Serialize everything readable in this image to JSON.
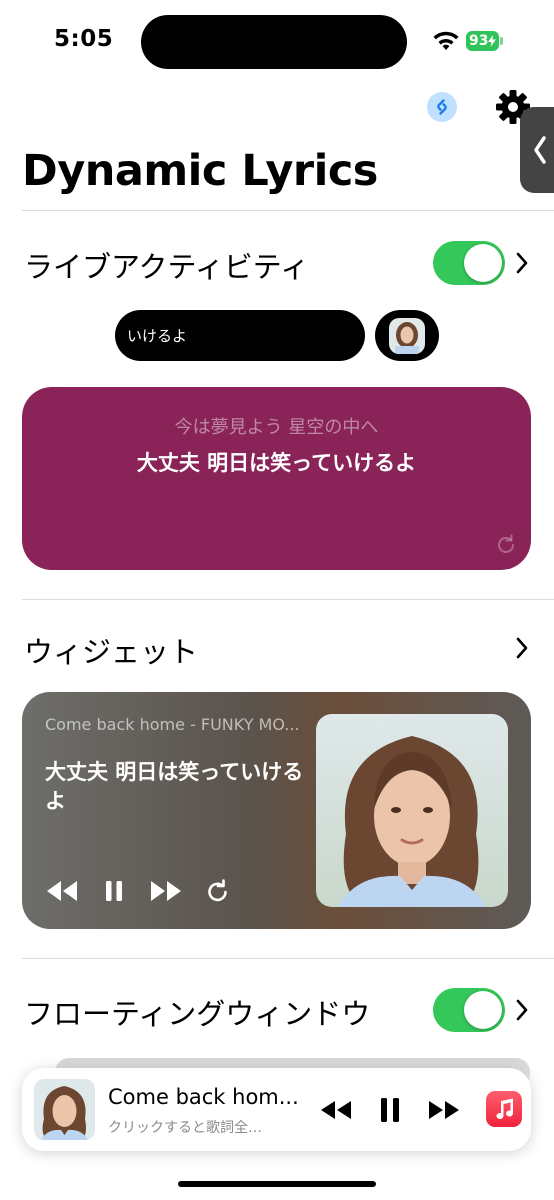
{
  "status_bar": {
    "time": "5:05",
    "battery": "93"
  },
  "header": {
    "title": "Dynamic Lyrics"
  },
  "live_activity": {
    "label": "ライブアクティビティ",
    "enabled": true,
    "island_text": "いけるよ",
    "previous_line": "今は夢見よう 星空の中へ",
    "current_line": "大丈夫 明日は笑っていけるよ",
    "card_color": "#8a2458"
  },
  "widget": {
    "label": "ウィジェット",
    "subtitle": "Come back home - FUNKY MO...",
    "lyric": "大丈夫 明日は笑っていけるよ"
  },
  "floating_window": {
    "label": "フローティングウィンドウ",
    "enabled": true
  },
  "mini_player": {
    "title": "Come back hom...",
    "subtitle": "クリックすると歌詞全…"
  },
  "colors": {
    "accent_toggle": "#34c759",
    "apple_music": "#f0243e"
  }
}
